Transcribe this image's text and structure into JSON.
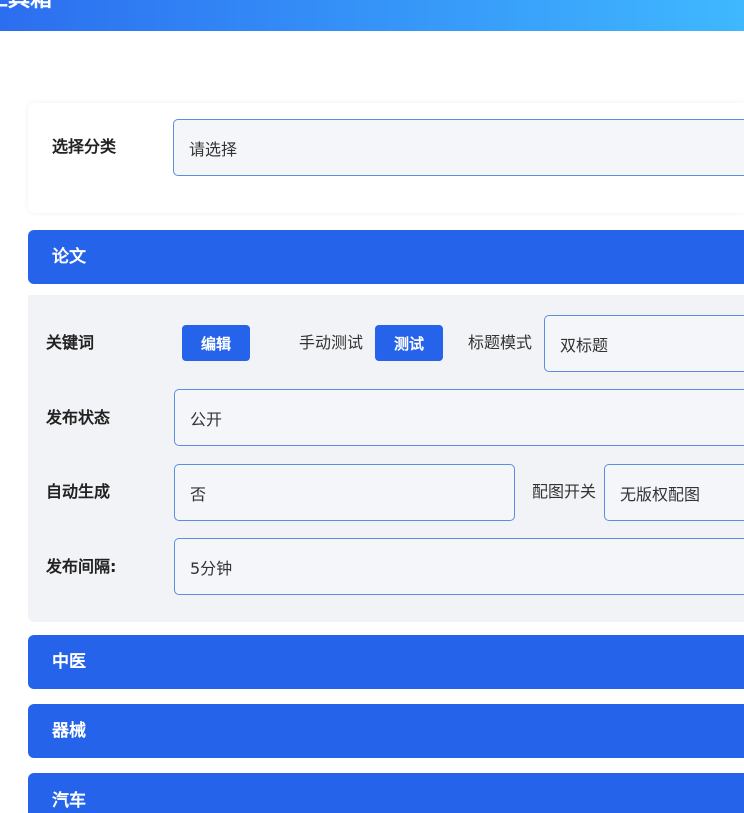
{
  "header": {
    "title": "工具箱"
  },
  "category": {
    "label": "选择分类",
    "placeholder": "请选择"
  },
  "sections": [
    {
      "title": "论文"
    },
    {
      "title": "中医"
    },
    {
      "title": "器械"
    },
    {
      "title": "汽车"
    }
  ],
  "paper": {
    "keywords_label": "关键词",
    "edit_button": "编辑",
    "manual_test_label": "手动测试",
    "test_button": "测试",
    "title_mode_label": "标题模式",
    "title_mode_value": "双标题",
    "publish_status_label": "发布状态",
    "publish_status_value": "公开",
    "auto_generate_label": "自动生成",
    "auto_generate_value": "否",
    "image_switch_label": "配图开关",
    "image_switch_value": "无版权配图",
    "publish_interval_label": "发布间隔:",
    "publish_interval_value": "5分钟"
  },
  "colors": {
    "header_gradient_start": "#2c6ef0",
    "header_gradient_end": "#3fb8ff",
    "section_bar": "#2563eb",
    "button": "#2563eb",
    "field_border": "#5a8ee3"
  }
}
